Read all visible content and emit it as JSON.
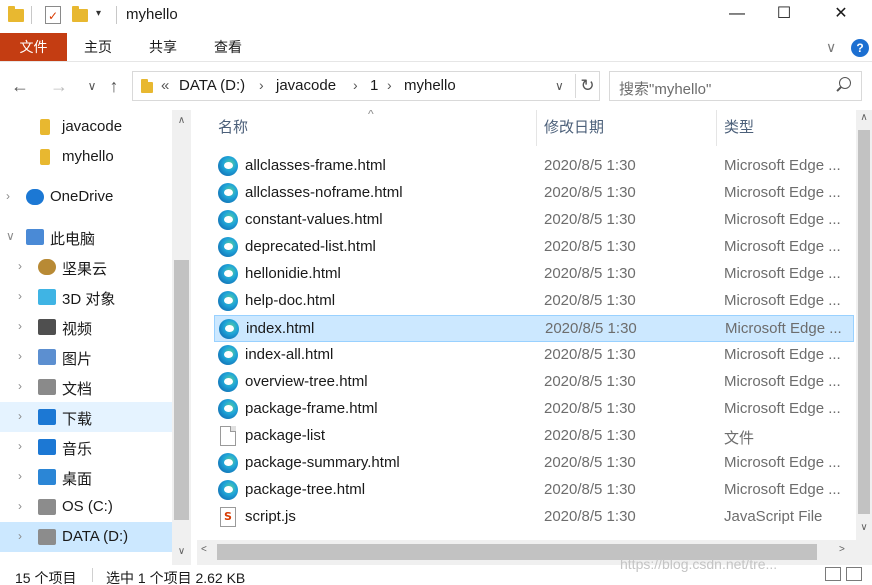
{
  "window": {
    "title": "myhello",
    "minimize": "—",
    "maximize": "☐",
    "close": "✕"
  },
  "ribbon": {
    "tabs": [
      "文件",
      "主页",
      "共享",
      "查看"
    ],
    "chevron": "∨",
    "help": "?"
  },
  "nav": {
    "back": "←",
    "forward": "→",
    "recent": "∨",
    "up": "↑",
    "address_overflow": "«",
    "breadcrumb": [
      "DATA (D:)",
      "javacode",
      "1",
      "myhello"
    ],
    "crumb_separator": "›",
    "address_dropdown": "∨",
    "refresh": "↻",
    "search_placeholder": "搜索\"myhello\""
  },
  "sidebar": {
    "items": [
      {
        "label": "javacode",
        "icon": "folder-icon",
        "arrow": ""
      },
      {
        "label": "myhello",
        "icon": "folder-icon",
        "arrow": ""
      },
      {
        "label": "OneDrive",
        "icon": "cloud-icon",
        "arrow": "›"
      },
      {
        "label": "此电脑",
        "icon": "computer-icon",
        "arrow": "∨"
      },
      {
        "label": "坚果云",
        "icon": "nut-icon",
        "arrow": "›"
      },
      {
        "label": "3D 对象",
        "icon": "cube-icon",
        "arrow": "›"
      },
      {
        "label": "视频",
        "icon": "video-icon",
        "arrow": "›"
      },
      {
        "label": "图片",
        "icon": "picture-icon",
        "arrow": "›"
      },
      {
        "label": "文档",
        "icon": "document-icon",
        "arrow": "›"
      },
      {
        "label": "下载",
        "icon": "download-icon",
        "arrow": "›"
      },
      {
        "label": "音乐",
        "icon": "music-icon",
        "arrow": "›"
      },
      {
        "label": "桌面",
        "icon": "desktop-icon",
        "arrow": "›"
      },
      {
        "label": "OS (C:)",
        "icon": "drive-icon",
        "arrow": "›"
      },
      {
        "label": "DATA (D:)",
        "icon": "drive-icon",
        "arrow": "›"
      }
    ],
    "selected": "DATA (D:)",
    "hover": "下载"
  },
  "columns": {
    "name": "名称",
    "date": "修改日期",
    "type": "类型",
    "sort_indicator": "^"
  },
  "files": [
    {
      "name": "allclasses-frame.html",
      "date": "2020/8/5 1:30",
      "type": "Microsoft Edge ...",
      "icon": "edge-icon"
    },
    {
      "name": "allclasses-noframe.html",
      "date": "2020/8/5 1:30",
      "type": "Microsoft Edge ...",
      "icon": "edge-icon"
    },
    {
      "name": "constant-values.html",
      "date": "2020/8/5 1:30",
      "type": "Microsoft Edge ...",
      "icon": "edge-icon"
    },
    {
      "name": "deprecated-list.html",
      "date": "2020/8/5 1:30",
      "type": "Microsoft Edge ...",
      "icon": "edge-icon"
    },
    {
      "name": "hellonidie.html",
      "date": "2020/8/5 1:30",
      "type": "Microsoft Edge ...",
      "icon": "edge-icon"
    },
    {
      "name": "help-doc.html",
      "date": "2020/8/5 1:30",
      "type": "Microsoft Edge ...",
      "icon": "edge-icon"
    },
    {
      "name": "index.html",
      "date": "2020/8/5 1:30",
      "type": "Microsoft Edge ...",
      "icon": "edge-icon",
      "selected": true
    },
    {
      "name": "index-all.html",
      "date": "2020/8/5 1:30",
      "type": "Microsoft Edge ...",
      "icon": "edge-icon"
    },
    {
      "name": "overview-tree.html",
      "date": "2020/8/5 1:30",
      "type": "Microsoft Edge ...",
      "icon": "edge-icon"
    },
    {
      "name": "package-frame.html",
      "date": "2020/8/5 1:30",
      "type": "Microsoft Edge ...",
      "icon": "edge-icon"
    },
    {
      "name": "package-list",
      "date": "2020/8/5 1:30",
      "type": "文件",
      "icon": "blank-file-icon"
    },
    {
      "name": "package-summary.html",
      "date": "2020/8/5 1:30",
      "type": "Microsoft Edge ...",
      "icon": "edge-icon"
    },
    {
      "name": "package-tree.html",
      "date": "2020/8/5 1:30",
      "type": "Microsoft Edge ...",
      "icon": "edge-icon"
    },
    {
      "name": "script.js",
      "date": "2020/8/5 1:30",
      "type": "JavaScript File",
      "icon": "js-file-icon"
    }
  ],
  "status": {
    "item_count": "15 个项目",
    "selection": "选中 1 个项目  2.62 KB"
  },
  "watermark": "https://blog.csdn.net/tre...",
  "colors": {
    "file_tab": "#c43d12",
    "selection": "#cce8ff",
    "selection_border": "#99d1ff",
    "help": "#1c6fd1",
    "folder": "#e8b830"
  }
}
